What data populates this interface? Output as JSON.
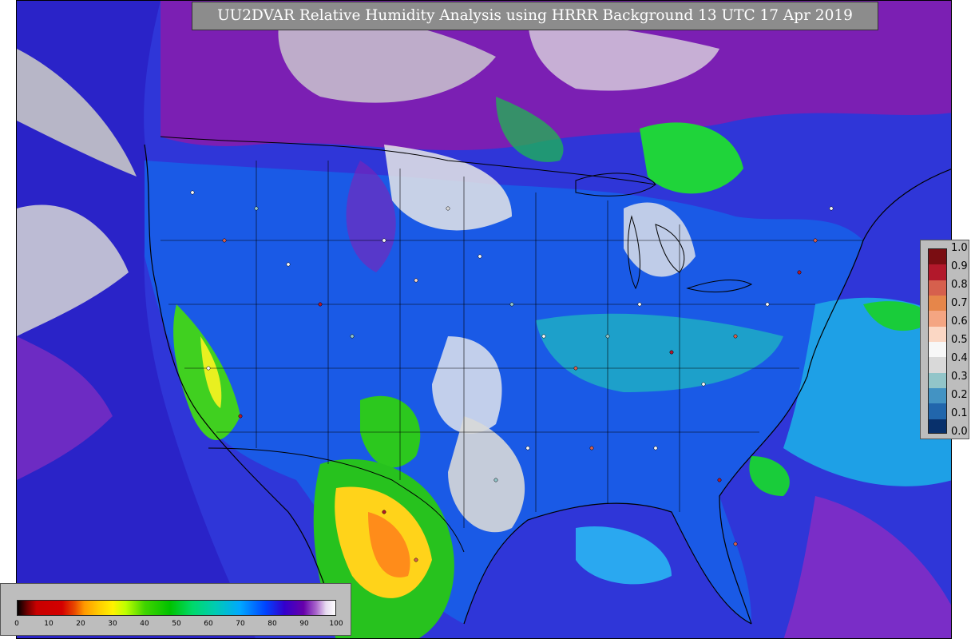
{
  "title": "UU2DVAR Relative Humidity Analysis using HRRR Background 13 UTC 17 Apr 2019",
  "map": {
    "field": "Relative Humidity",
    "background_model": "HRRR",
    "region": "CONUS"
  },
  "observation_legend": {
    "labels": [
      "1.0",
      "0.9",
      "0.8",
      "0.7",
      "0.6",
      "0.5",
      "0.4",
      "0.3",
      "0.2",
      "0.1",
      "0.0"
    ],
    "colors": [
      "#7a0d12",
      "#b2182b",
      "#d6604d",
      "#e6864a",
      "#f4a582",
      "#fbd7c4",
      "#f7f7f7",
      "#d9d9d9",
      "#92c5c9",
      "#4393c3",
      "#2166ac",
      "#08306b"
    ]
  },
  "rh_colorbar": {
    "ticks": [
      "0",
      "10",
      "20",
      "30",
      "40",
      "50",
      "60",
      "70",
      "80",
      "90",
      "100"
    ]
  },
  "colors": {
    "land_bg": "#2a2fd6",
    "very_moist": "#e0e0e0",
    "moist": "#7a16b0",
    "mid": "#1a8ce8",
    "dry_green": "#16c41a",
    "very_dry": "#ffd21a"
  }
}
